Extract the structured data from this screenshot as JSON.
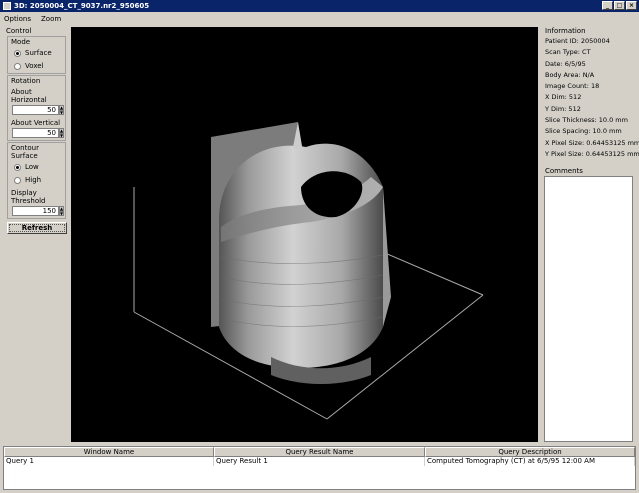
{
  "window": {
    "title": "3D: 2050004_CT_9037.nr2_950605"
  },
  "menu": [
    "Options",
    "Zoom"
  ],
  "control": {
    "title": "Control",
    "mode": {
      "title": "Mode",
      "options": [
        "Surface",
        "Voxel"
      ],
      "selected": "Surface"
    },
    "rotation": {
      "title": "Rotation",
      "horizontal_label": "About Horizontal",
      "horizontal_value": "50",
      "vertical_label": "About Vertical",
      "vertical_value": "50"
    },
    "contour": {
      "title": "Contour Surface",
      "options": [
        "Low",
        "High"
      ],
      "selected": "Low"
    },
    "threshold": {
      "label": "Display Threshold",
      "value": "150"
    },
    "refresh_label": "Refresh"
  },
  "information": {
    "title": "Information",
    "lines": [
      "Patient ID: 2050004",
      "Scan Type: CT",
      "Date: 6/5/95",
      "Body Area: N/A",
      "Image Count: 18",
      "X Dim: 512",
      "Y Dim: 512",
      "Slice Thickness: 10.0 mm",
      "Slice Spacing: 10.0 mm",
      "X Pixel Size: 0.64453125 mm",
      "Y Pixel Size: 0.64453125 mm"
    ]
  },
  "comments": {
    "title": "Comments",
    "text": ""
  },
  "table": {
    "columns": [
      "Window Name",
      "Query Result Name",
      "Query Description"
    ],
    "rows": [
      [
        "Query 1",
        "Query Result 1",
        "Computed Tomography (CT) at 6/5/95 12:00 AM"
      ]
    ]
  }
}
